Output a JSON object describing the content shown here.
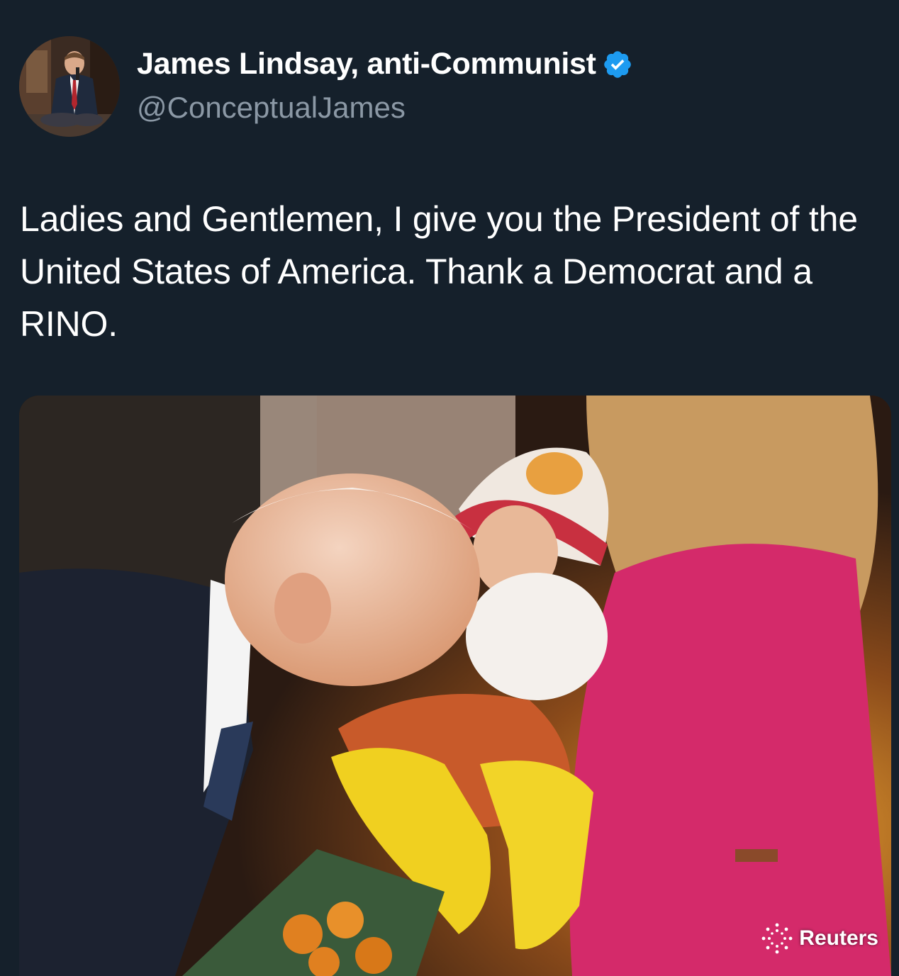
{
  "tweet": {
    "author": {
      "display_name": "James Lindsay, anti-Communist",
      "handle": "@ConceptualJames",
      "verified": true,
      "verified_color": "#1d9bf0",
      "avatar_icon": "profile-photo"
    },
    "text": "Ladies and Gentlemen, I give you the President of the United States of America. Thank a Democrat and a RINO.",
    "media": {
      "kind": "photo",
      "watermark": "Reuters"
    }
  },
  "colors": {
    "background": "#15202b",
    "text_primary": "#ffffff",
    "text_secondary": "#8b98a5"
  }
}
